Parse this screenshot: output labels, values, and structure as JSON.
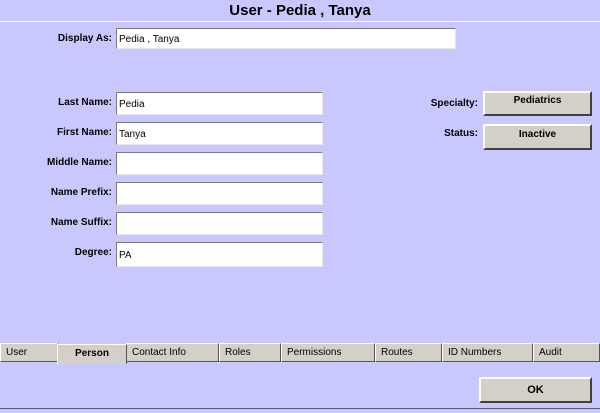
{
  "window": {
    "title": "User - Pedia , Tanya"
  },
  "form": {
    "display_as": {
      "label": "Display As:",
      "value": "Pedia , Tanya"
    },
    "last_name": {
      "label": "Last Name:",
      "value": "Pedia"
    },
    "first_name": {
      "label": "First Name:",
      "value": "Tanya"
    },
    "middle_name": {
      "label": "Middle Name:",
      "value": ""
    },
    "name_prefix": {
      "label": "Name Prefix:",
      "value": ""
    },
    "name_suffix": {
      "label": "Name Suffix:",
      "value": ""
    },
    "degree": {
      "label": "Degree:",
      "value": "PA"
    },
    "specialty": {
      "label": "Specialty:",
      "value": "Pediatrics"
    },
    "status": {
      "label": "Status:",
      "value": "Inactive"
    }
  },
  "tabs": [
    {
      "label": "User",
      "active": false
    },
    {
      "label": "Person",
      "active": true
    },
    {
      "label": "Contact Info",
      "active": false
    },
    {
      "label": "Roles",
      "active": false
    },
    {
      "label": "Permissions",
      "active": false
    },
    {
      "label": "Routes",
      "active": false
    },
    {
      "label": "ID Numbers",
      "active": false
    },
    {
      "label": "Audit",
      "active": false
    }
  ],
  "footer": {
    "ok_label": "OK"
  },
  "colors": {
    "background": "#c8c8ff",
    "button": "#d4d0c8"
  }
}
